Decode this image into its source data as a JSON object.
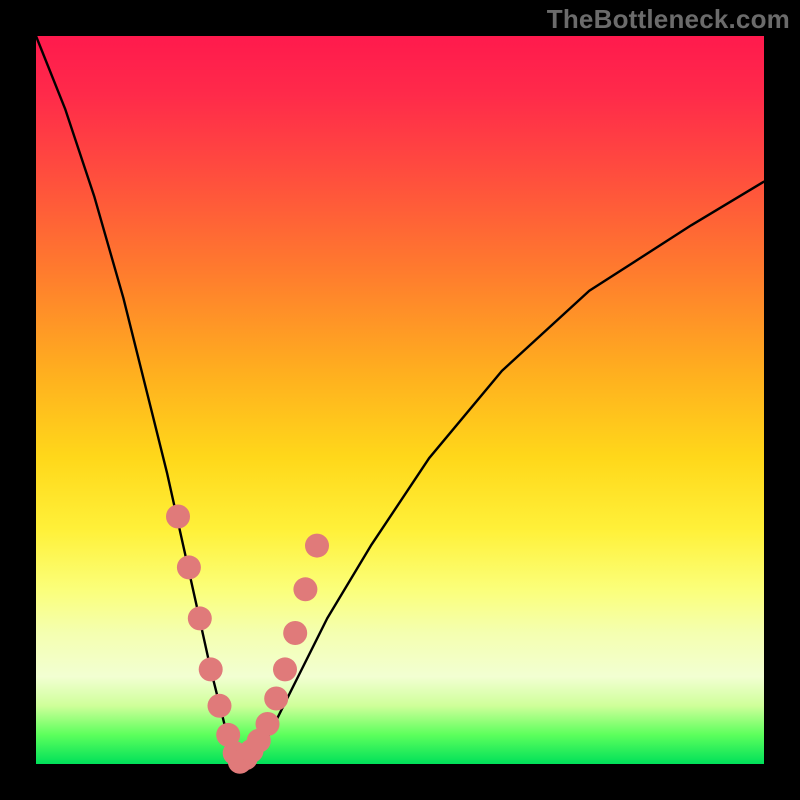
{
  "watermark": "TheBottleneck.com",
  "colors": {
    "curve_stroke": "#000000",
    "marker_fill": "#e07a7a",
    "marker_stroke": "#d66a6a",
    "gradient_stops": [
      "#ff1a4d",
      "#ff4a3f",
      "#ffae1f",
      "#fff13a",
      "#f2ffd2",
      "#00e05a"
    ]
  },
  "chart_data": {
    "type": "line",
    "title": "",
    "xlabel": "",
    "ylabel": "",
    "xlim": [
      0,
      100
    ],
    "ylim": [
      0,
      100
    ],
    "grid": false,
    "legend": null,
    "notes": "Bottleneck-style V curve over red→green vertical gradient. Minimum near x≈28. No axis ticks or numeric labels visible.",
    "series": [
      {
        "name": "bottleneck_curve",
        "x": [
          0,
          4,
          8,
          12,
          16,
          18,
          20,
          22,
          24,
          26,
          27,
          28,
          29,
          30,
          32,
          34,
          36,
          40,
          46,
          54,
          64,
          76,
          90,
          100
        ],
        "y": [
          100,
          90,
          78,
          64,
          48,
          40,
          31,
          22,
          13,
          5,
          2,
          0,
          1,
          2,
          4,
          8,
          12,
          20,
          30,
          42,
          54,
          65,
          74,
          80
        ]
      }
    ],
    "markers": {
      "name": "highlighted_points",
      "approx_radius_px": 12,
      "x": [
        19.5,
        21.0,
        22.5,
        24.0,
        25.2,
        26.4,
        27.3,
        28.0,
        28.8,
        29.6,
        30.6,
        31.8,
        33.0,
        34.2,
        35.6,
        37.0,
        38.6
      ],
      "y": [
        34.0,
        27.0,
        20.0,
        13.0,
        8.0,
        4.0,
        1.5,
        0.3,
        0.8,
        1.8,
        3.2,
        5.5,
        9.0,
        13.0,
        18.0,
        24.0,
        30.0
      ]
    }
  }
}
